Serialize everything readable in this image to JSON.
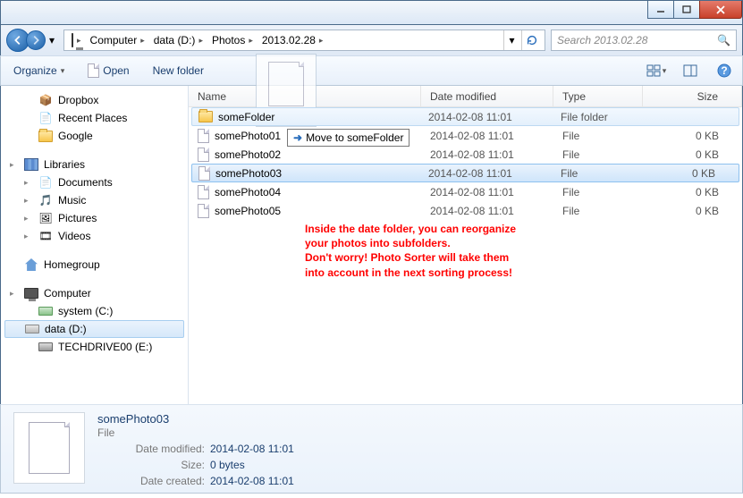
{
  "titlebar": {
    "minimize": "–",
    "maximize": "□",
    "close": "✕"
  },
  "nav": {
    "crumbs": [
      "Computer",
      "data (D:)",
      "Photos",
      "2013.02.28"
    ],
    "search_placeholder": "Search 2013.02.28"
  },
  "toolbar": {
    "organize": "Organize",
    "open": "Open",
    "newfolder": "New folder"
  },
  "sidebar": {
    "favorites": [
      {
        "label": "Dropbox"
      },
      {
        "label": "Recent Places"
      },
      {
        "label": "Google"
      }
    ],
    "libraries_label": "Libraries",
    "libraries": [
      {
        "label": "Documents"
      },
      {
        "label": "Music"
      },
      {
        "label": "Pictures"
      },
      {
        "label": "Videos"
      }
    ],
    "homegroup_label": "Homegroup",
    "computer_label": "Computer",
    "drives": [
      {
        "label": "system (C:)"
      },
      {
        "label": "data (D:)"
      },
      {
        "label": "TECHDRIVE00 (E:)"
      }
    ]
  },
  "columns": {
    "name": "Name",
    "date": "Date modified",
    "type": "Type",
    "size": "Size"
  },
  "files": [
    {
      "name": "someFolder",
      "date": "2014-02-08 11:01",
      "type": "File folder",
      "size": "",
      "kind": "folder",
      "state": "hov"
    },
    {
      "name": "somePhoto01",
      "date": "2014-02-08 11:01",
      "type": "File",
      "size": "0 KB",
      "kind": "file",
      "state": ""
    },
    {
      "name": "somePhoto02",
      "date": "2014-02-08 11:01",
      "type": "File",
      "size": "0 KB",
      "kind": "file",
      "state": ""
    },
    {
      "name": "somePhoto03",
      "date": "2014-02-08 11:01",
      "type": "File",
      "size": "0 KB",
      "kind": "file",
      "state": "sel"
    },
    {
      "name": "somePhoto04",
      "date": "2014-02-08 11:01",
      "type": "File",
      "size": "0 KB",
      "kind": "file",
      "state": ""
    },
    {
      "name": "somePhoto05",
      "date": "2014-02-08 11:01",
      "type": "File",
      "size": "0 KB",
      "kind": "file",
      "state": ""
    }
  ],
  "drag_tooltip": "Move to someFolder",
  "annotation": {
    "l1": "Inside the date folder, you can reorganize",
    "l2": "your photos into subfolders.",
    "l3": "Don't worry! Photo Sorter will take them",
    "l4": "into account in the next sorting process!"
  },
  "details": {
    "name": "somePhoto03",
    "type": "File",
    "k_modified": "Date modified:",
    "v_modified": "2014-02-08 11:01",
    "k_size": "Size:",
    "v_size": "0 bytes",
    "k_created": "Date created:",
    "v_created": "2014-02-08 11:01"
  }
}
